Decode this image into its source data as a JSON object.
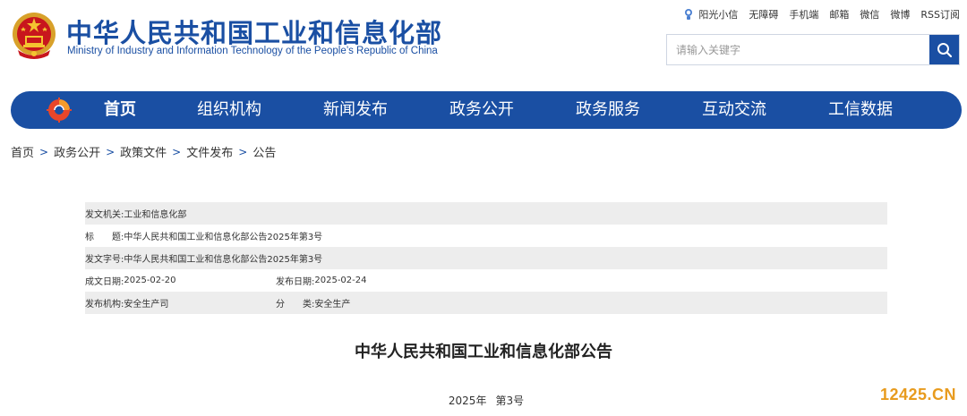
{
  "header": {
    "title_cn": "中华人民共和国工业和信息化部",
    "title_en": "Ministry of Industry and Information Technology of the People’s Republic of China",
    "top_links": [
      "阳光小信",
      "无障碍",
      "手机端",
      "邮箱",
      "微信",
      "微博",
      "RSS订阅"
    ],
    "search": {
      "placeholder": "请输入关键字"
    }
  },
  "nav": {
    "items": [
      "首页",
      "组织机构",
      "新闻发布",
      "政务公开",
      "政务服务",
      "互动交流",
      "工信数据"
    ],
    "active": "首页"
  },
  "breadcrumb": [
    "首页",
    "政务公开",
    "政策文件",
    "文件发布",
    "公告"
  ],
  "info": {
    "issuer_label": "发文机关:",
    "issuer": "工业和信息化部",
    "title_label": "标　　题:",
    "title": "中华人民共和国工业和信息化部公告2025年第3号",
    "doc_no_label": "发文字号:",
    "doc_no": "中华人民共和国工业和信息化部公告2025年第3号",
    "created_label": "成文日期:",
    "created": "2025-02-20",
    "published_label": "发布日期:",
    "published": "2025-02-24",
    "org_label": "发布机构:",
    "org": "安全生产司",
    "category_label": "分　　类:",
    "category": "安全生产"
  },
  "article": {
    "title": "中华人民共和国工业和信息化部公告",
    "year": "2025年",
    "number": "第3号"
  },
  "watermark": "12425.CN",
  "colors": {
    "brand_blue": "#1a4fa3",
    "row_shade": "#ededed",
    "watermark": "#e89b1e"
  },
  "icons": {
    "search": "search-icon",
    "emblem": "national-emblem-icon",
    "nav_logo": "miit-logo-icon",
    "sun": "sun-mascot-icon"
  }
}
